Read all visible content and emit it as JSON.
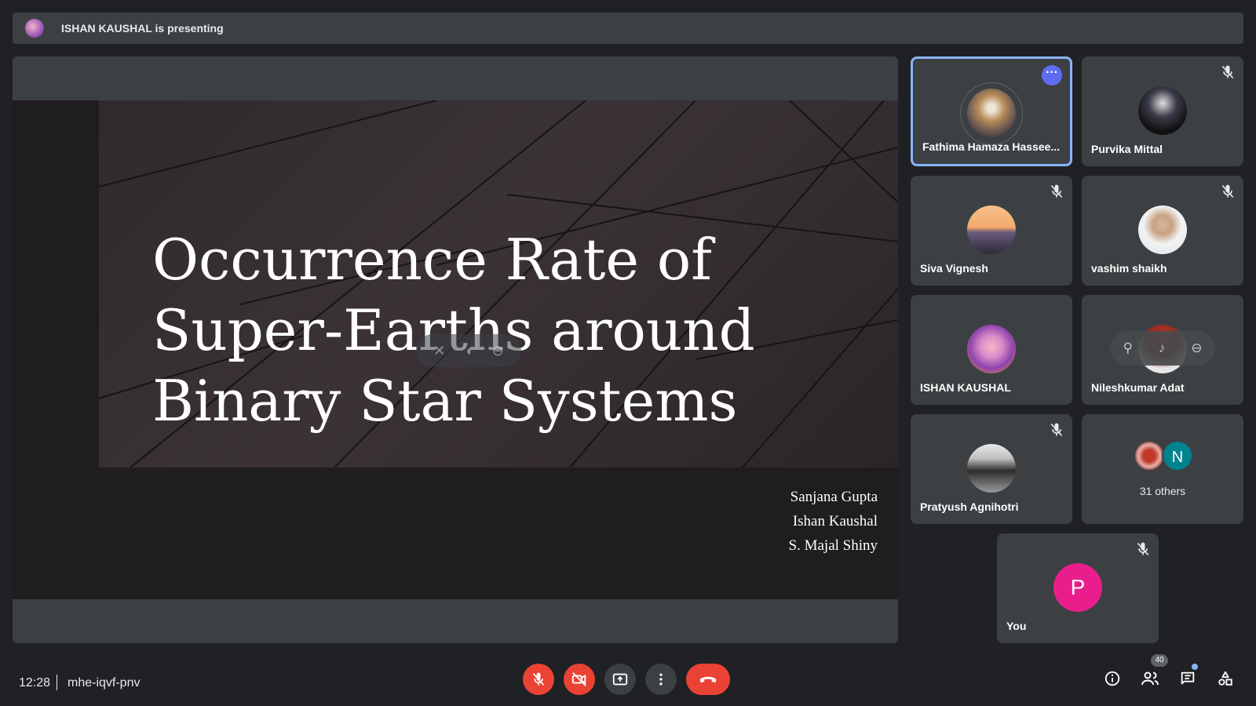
{
  "banner": {
    "text": "ISHAN KAUSHAL is presenting"
  },
  "slide": {
    "title_lines": [
      "Occurrence Rate of",
      "Super-Earths around",
      "Binary  Star Systems"
    ],
    "authors": [
      "Sanjana Gupta",
      "Ishan Kaushal",
      "S. Majal Shiny"
    ]
  },
  "participants": [
    {
      "name": "Fathima Hamaza Hassee...",
      "muted": false,
      "active": true,
      "icon": "more-options-icon"
    },
    {
      "name": "Purvika Mittal",
      "muted": true
    },
    {
      "name": "Siva Vignesh",
      "muted": true
    },
    {
      "name": "vashim shaikh",
      "muted": true
    },
    {
      "name": "ISHAN KAUSHAL",
      "muted": false
    },
    {
      "name": "Nileshkumar Adat",
      "muted": false
    },
    {
      "name": "Pratyush Agnihotri",
      "muted": true
    }
  ],
  "others": {
    "initial": "N",
    "label": "31 others"
  },
  "you": {
    "initial": "P",
    "label": "You"
  },
  "meeting": {
    "time": "12:28",
    "code": "mhe-iqvf-pnv"
  },
  "people_count": "40",
  "colors": {
    "accent": "#8ab4f8",
    "danger": "#ea4335",
    "tile": "#3c4043",
    "background": "#202124",
    "you_avatar": "#e91e8c"
  }
}
